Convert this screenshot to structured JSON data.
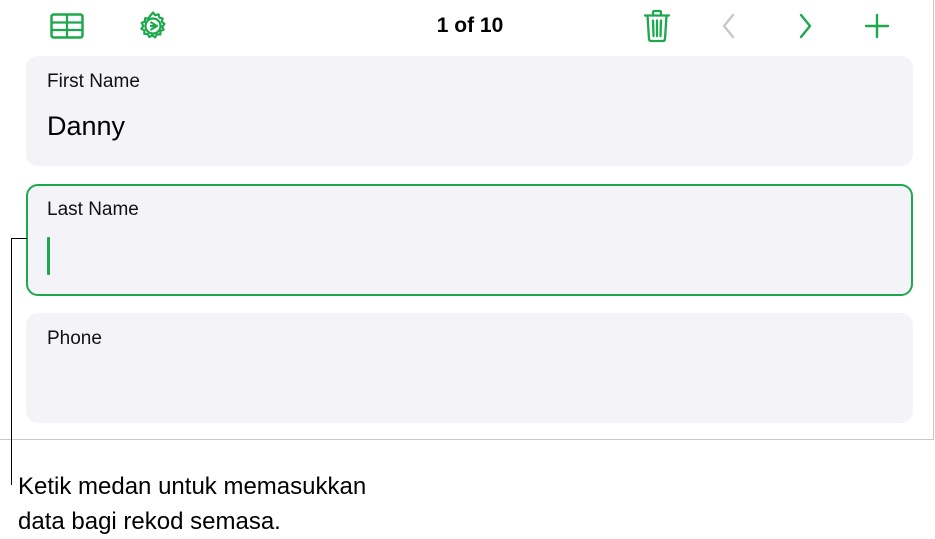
{
  "toolbar": {
    "record_counter": "1 of 10",
    "icons": {
      "table": "table-icon",
      "settings": "gear-icon",
      "delete": "trash-icon",
      "previous": "chevron-left-icon",
      "next": "chevron-right-icon",
      "add": "plus-icon"
    },
    "previous_enabled": false
  },
  "fields": [
    {
      "label": "First Name",
      "value": "Danny",
      "active": false
    },
    {
      "label": "Last Name",
      "value": "",
      "active": true
    },
    {
      "label": "Phone",
      "value": "",
      "active": false
    }
  ],
  "callout": {
    "line1": "Ketik medan untuk memasukkan",
    "line2": "data bagi rekod semasa."
  },
  "colors": {
    "accent": "#1ea84d",
    "disabled": "#c7c7cc",
    "card_background": "#f4f4f8"
  }
}
